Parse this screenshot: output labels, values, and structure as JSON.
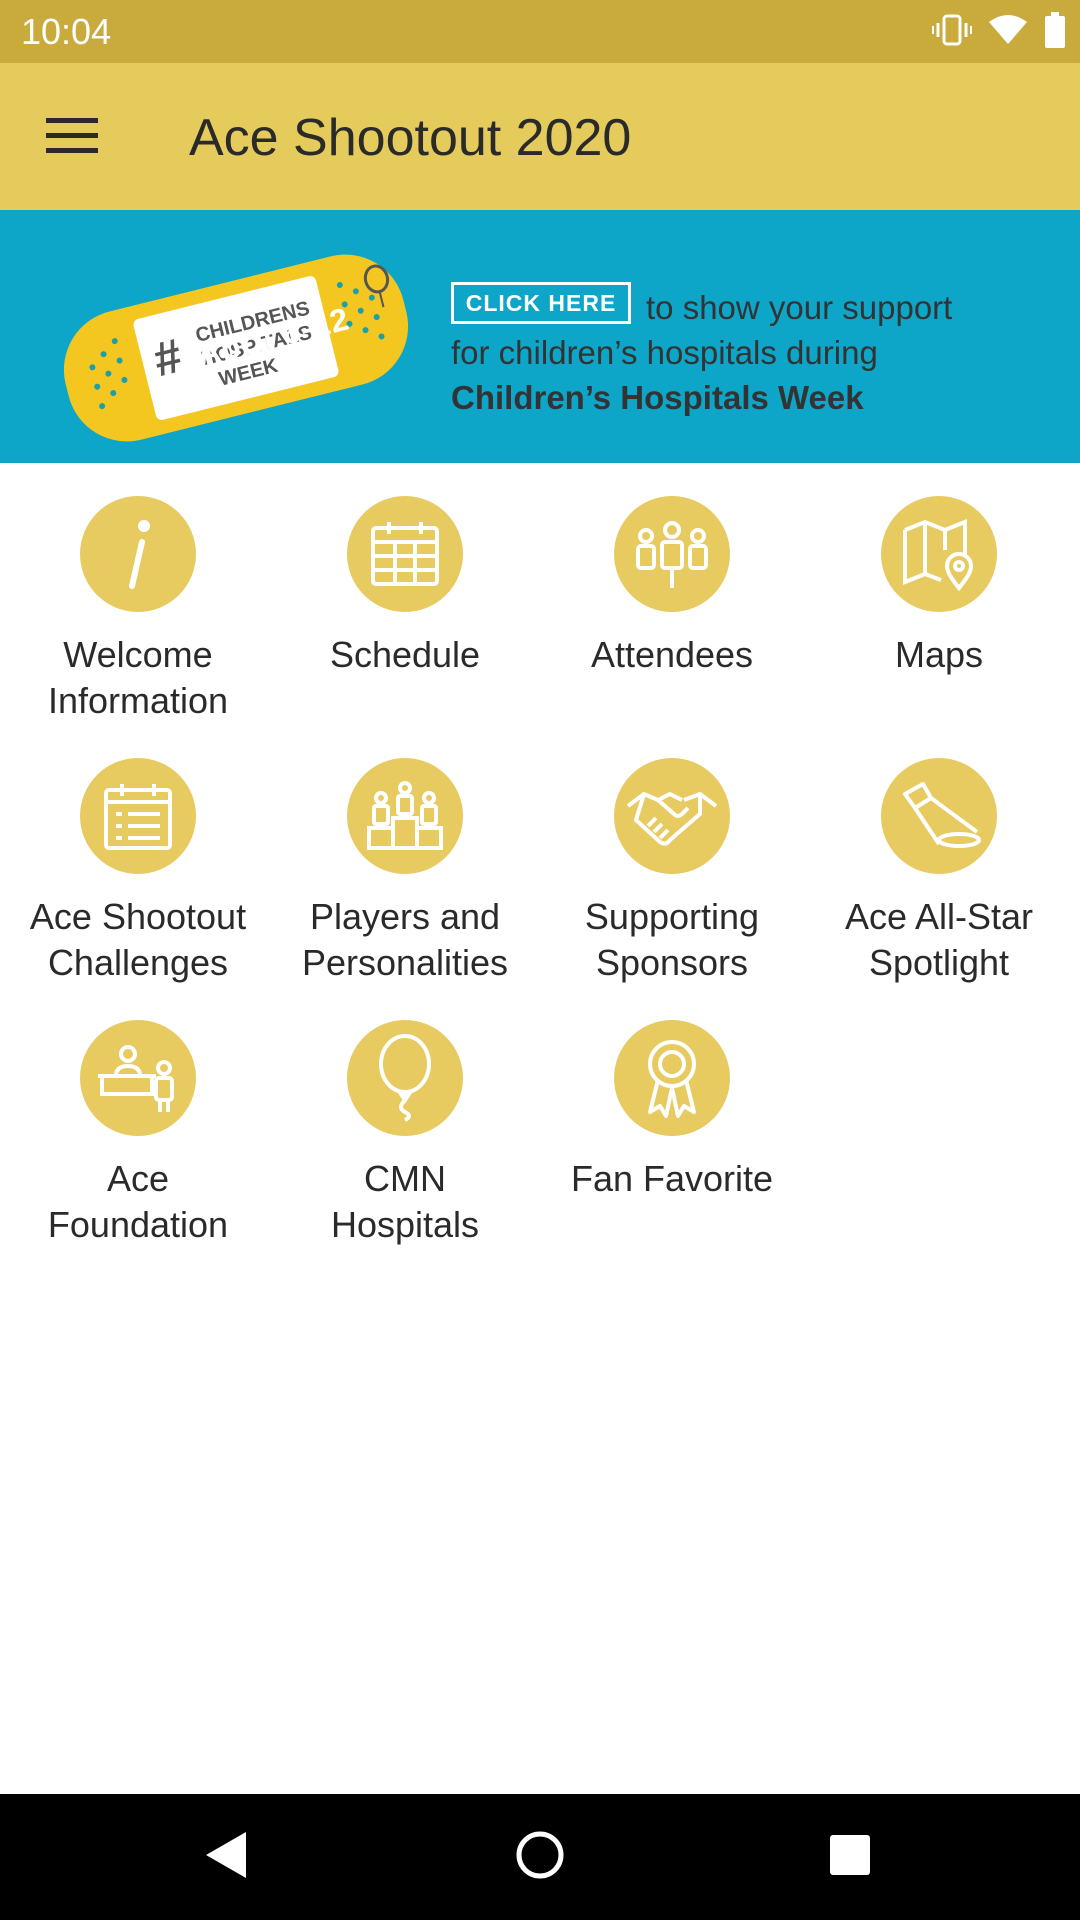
{
  "status_bar": {
    "time": "10:04",
    "icons": [
      "vibrate-icon",
      "wifi-icon",
      "battery-icon"
    ]
  },
  "app_bar": {
    "menu_icon": "hamburger-menu-icon",
    "title": "Ace Shootout 2020"
  },
  "banner": {
    "bandage_hash": "#",
    "bandage_lines": [
      "CHILDRENS",
      "HOSPITALS",
      "WEEK"
    ],
    "dates": "April 6-12",
    "click_here": "CLICK HERE",
    "line1": "to show your support",
    "line2": "for children’s hospitals during",
    "line3": "Children’s Hospitals Week"
  },
  "grid": {
    "items": [
      {
        "label": "Welcome\nInformation",
        "icon": "info-icon"
      },
      {
        "label": "Schedule",
        "icon": "calendar-icon"
      },
      {
        "label": "Attendees",
        "icon": "people-icon"
      },
      {
        "label": "Maps",
        "icon": "map-icon"
      },
      {
        "label": "Ace Shootout\nChallenges",
        "icon": "checklist-icon"
      },
      {
        "label": "Players and\nPersonalities",
        "icon": "podium-icon"
      },
      {
        "label": "Supporting\nSponsors",
        "icon": "handshake-icon"
      },
      {
        "label": "Ace All-Star\nSpotlight",
        "icon": "spotlight-icon"
      },
      {
        "label": "Ace\nFoundation",
        "icon": "desk-icon"
      },
      {
        "label": "CMN\nHospitals",
        "icon": "balloon-icon"
      },
      {
        "label": "Fan Favorite",
        "icon": "ribbon-award-icon"
      }
    ]
  },
  "nav_bar": {
    "back": "back-icon",
    "home": "home-icon",
    "recents": "recents-icon"
  },
  "colors": {
    "status_bar": "#c9ab3d",
    "app_bar": "#e5cb5b",
    "banner": "#0da6c9",
    "icon_circle": "#e7cb61"
  }
}
